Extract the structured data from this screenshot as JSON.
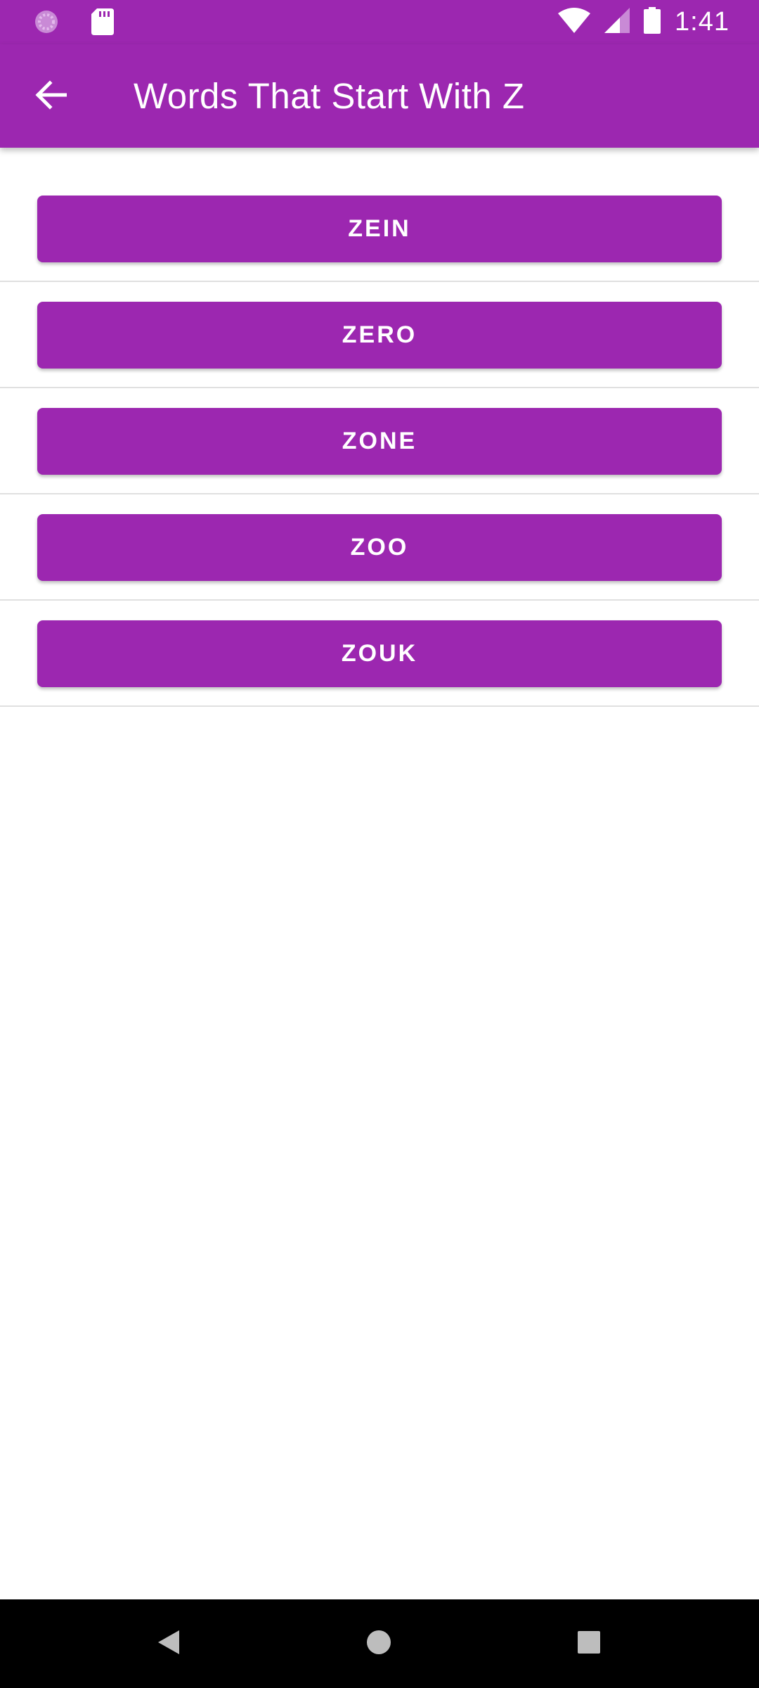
{
  "status_bar": {
    "time": "1:41",
    "icons": [
      "loading-icon",
      "sd-card-icon",
      "wifi-icon",
      "signal-icon",
      "battery-icon"
    ]
  },
  "app_bar": {
    "title": "Words That Start With Z",
    "back_icon": "arrow-back-icon"
  },
  "words": [
    {
      "label": "ZEIN"
    },
    {
      "label": "ZERO"
    },
    {
      "label": "ZONE"
    },
    {
      "label": "ZOO"
    },
    {
      "label": "ZOUK"
    }
  ],
  "nav_bar": {
    "icons": [
      "back-triangle-icon",
      "home-circle-icon",
      "recents-square-icon"
    ]
  },
  "colors": {
    "primary": "#9c27b0",
    "on_primary": "#ffffff",
    "divider": "#e0e0e0",
    "nav_background": "#000000"
  }
}
